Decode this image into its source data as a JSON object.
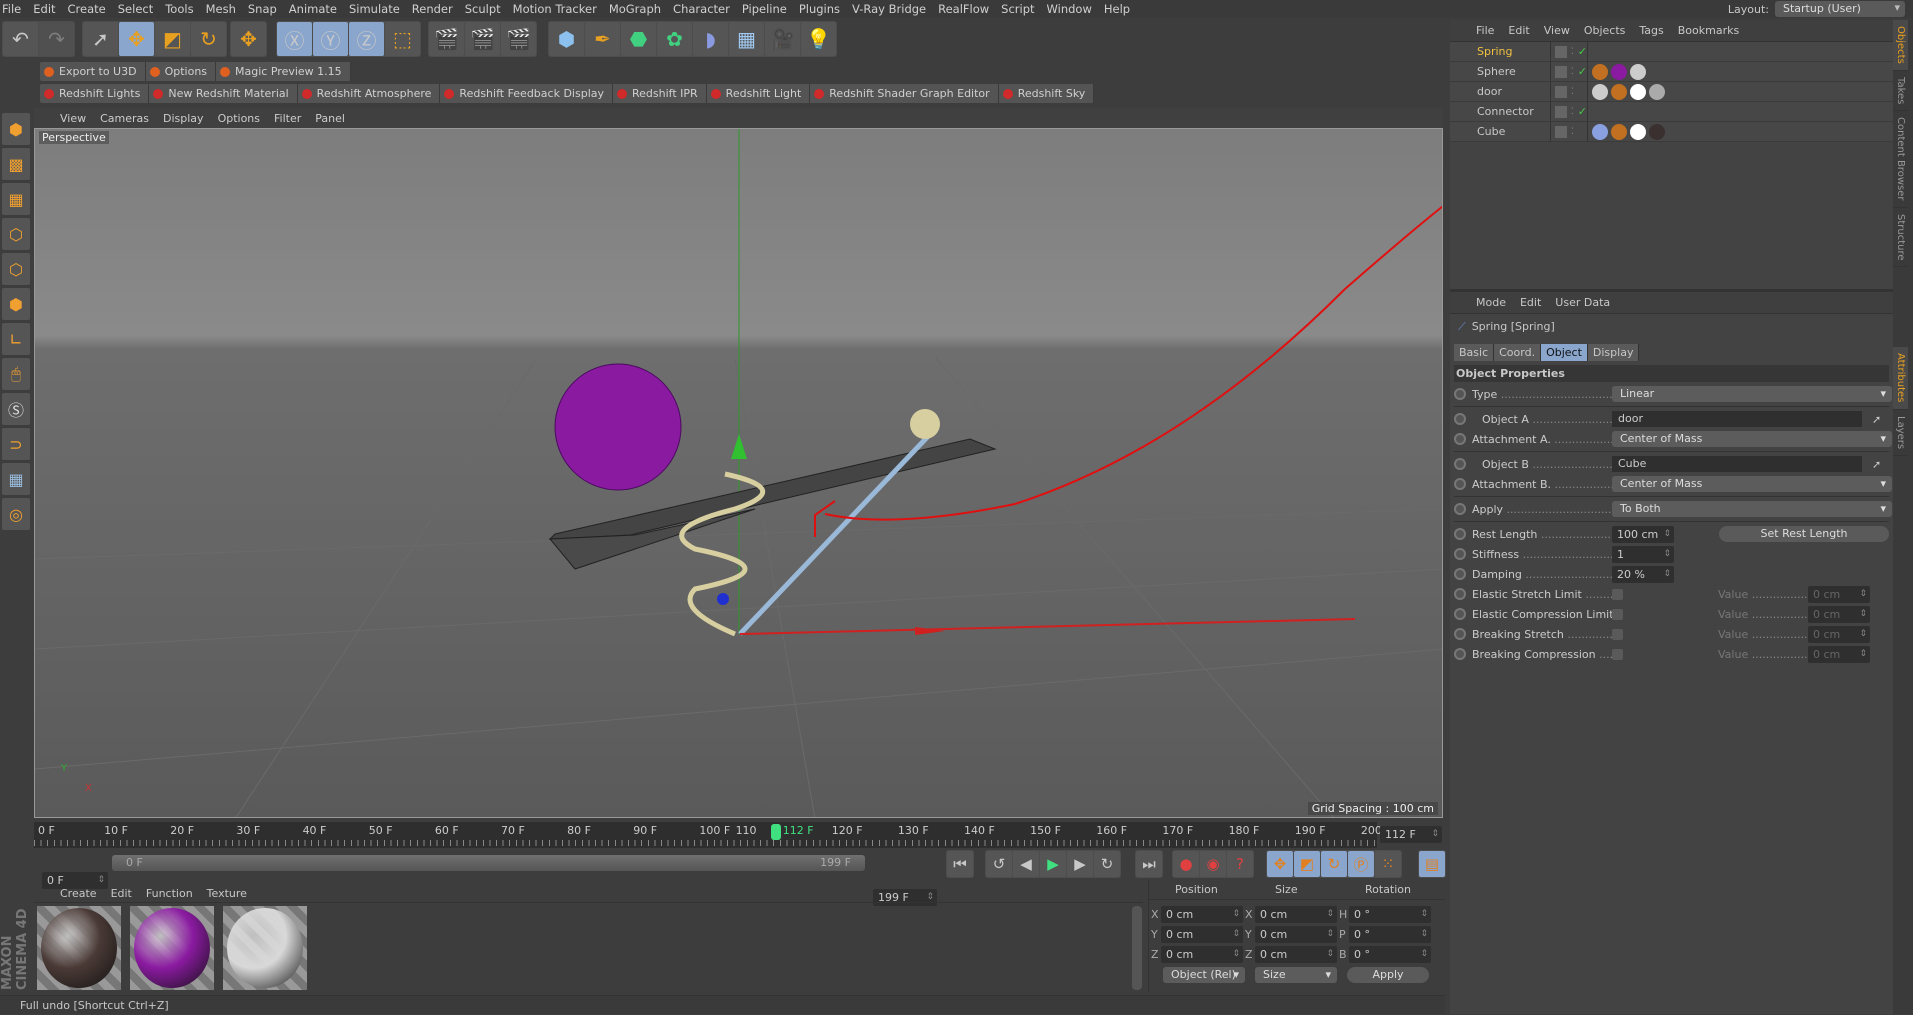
{
  "menu": [
    "File",
    "Edit",
    "Create",
    "Select",
    "Tools",
    "Mesh",
    "Snap",
    "Animate",
    "Simulate",
    "Render",
    "Sculpt",
    "Motion Tracker",
    "MoGraph",
    "Character",
    "Pipeline",
    "Plugins",
    "V-Ray Bridge",
    "RealFlow",
    "Script",
    "Window",
    "Help"
  ],
  "layout": {
    "label": "Layout:",
    "value": "Startup (User)"
  },
  "plugins_row1": [
    "Export to U3D",
    "Options",
    "Magic Preview 1.15"
  ],
  "plugins_row2": [
    "Redshift Lights",
    "New Redshift Material",
    "Redshift Atmosphere",
    "Redshift Feedback Display",
    "Redshift IPR",
    "Redshift Light",
    "Redshift Shader Graph Editor",
    "Redshift Sky"
  ],
  "viewport": {
    "menu": [
      "View",
      "Cameras",
      "Display",
      "Options",
      "Filter",
      "Panel"
    ],
    "label": "Perspective",
    "grid_spacing": "Grid Spacing : 100 cm"
  },
  "timeline": {
    "ticks": [
      "0 F",
      "10 F",
      "20 F",
      "30 F",
      "40 F",
      "50 F",
      "60 F",
      "70 F",
      "80 F",
      "90 F",
      "100 F",
      "110",
      "120 F",
      "130 F",
      "140 F",
      "150 F",
      "160 F",
      "170 F",
      "180 F",
      "190 F",
      "200"
    ],
    "current": "112 F",
    "current_field": "112 F",
    "start": "0 F",
    "range_start": "0 F",
    "range_end": "199 F",
    "end": "199 F",
    "current_frame": 112,
    "max_frame": 200
  },
  "materials": {
    "menu": [
      "Create",
      "Edit",
      "Function",
      "Texture"
    ],
    "colors": [
      "#4a3a36",
      "#8a1aa0",
      "#d8d8d8"
    ]
  },
  "coords": {
    "headers": [
      "Position",
      "Size",
      "Rotation"
    ],
    "rows": [
      [
        "X",
        "0 cm",
        "X",
        "0 cm",
        "H",
        "0 °"
      ],
      [
        "Y",
        "0 cm",
        "Y",
        "0 cm",
        "P",
        "0 °"
      ],
      [
        "Z",
        "0 cm",
        "Z",
        "0 cm",
        "B",
        "0 °"
      ]
    ],
    "mode": "Object (Rel)",
    "size_mode": "Size",
    "apply": "Apply"
  },
  "status": "Full undo [Shortcut Ctrl+Z]",
  "objects": {
    "menu": [
      "File",
      "Edit",
      "View",
      "Objects",
      "Tags",
      "Bookmarks"
    ],
    "items": [
      {
        "name": "Spring",
        "selected": true
      },
      {
        "name": "Sphere"
      },
      {
        "name": "door"
      },
      {
        "name": "Connector"
      },
      {
        "name": "Cube"
      }
    ]
  },
  "attributes": {
    "menu": [
      "Mode",
      "Edit",
      "User Data"
    ],
    "title": "Spring [Spring]",
    "tabs": [
      "Basic",
      "Coord.",
      "Object",
      "Display"
    ],
    "active_tab": "Object",
    "section": "Object Properties",
    "type": {
      "label": "Type",
      "value": "Linear"
    },
    "object_a": {
      "label": "Object A",
      "value": "door"
    },
    "attach_a": {
      "label": "Attachment A.",
      "value": "Center of Mass"
    },
    "object_b": {
      "label": "Object B",
      "value": "Cube"
    },
    "attach_b": {
      "label": "Attachment B.",
      "value": "Center of Mass"
    },
    "apply": {
      "label": "Apply",
      "value": "To Both"
    },
    "rest_length": {
      "label": "Rest Length",
      "value": "100 cm"
    },
    "set_rest": "Set Rest Length",
    "stiffness": {
      "label": "Stiffness",
      "value": "1"
    },
    "damping": {
      "label": "Damping",
      "value": "20 %"
    },
    "limits": [
      {
        "label": "Elastic Stretch Limit",
        "value_label": "Value",
        "value": "0 cm"
      },
      {
        "label": "Elastic Compression Limit",
        "value_label": "Value",
        "value": "0 cm"
      },
      {
        "label": "Breaking Stretch",
        "value_label": "Value",
        "value": "0 cm"
      },
      {
        "label": "Breaking Compression",
        "value_label": "Value",
        "value": "0 cm"
      }
    ]
  },
  "side_tabs": [
    "Objects",
    "Takes",
    "Content Browser",
    "Structure"
  ],
  "side_tabs2": [
    "Attributes",
    "Layers"
  ]
}
